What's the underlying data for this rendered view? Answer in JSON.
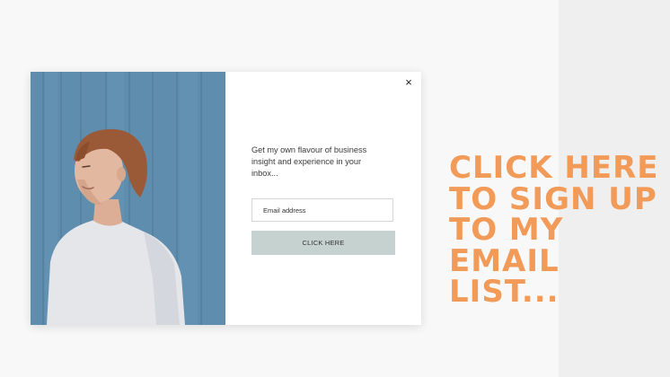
{
  "popup": {
    "close_symbol": "×",
    "intro_text": "Get my own flavour of business insight and experience in your inbox...",
    "email_placeholder": "Email address",
    "submit_label": "CLICK HERE",
    "photo_background_color": "#5f8dad"
  },
  "cta": {
    "lines": [
      "CLICK HERE",
      "TO SIGN UP",
      "TO MY",
      "EMAIL",
      "LIST..."
    ],
    "color": "#f29a58"
  },
  "icons": {
    "close": "close-icon"
  }
}
